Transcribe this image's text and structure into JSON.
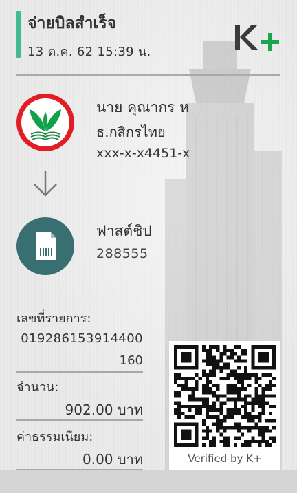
{
  "header": {
    "title": "จ่ายบิลสำเร็จ",
    "datetime": "13 ต.ค. 62  15:39 น.",
    "logo_text": "K+",
    "accent_color": "#43b98f"
  },
  "sender": {
    "name": "นาย คุณากร ห",
    "bank": "ธ.กสิกรไทย",
    "account": "xxx-x-x4451-x",
    "logo_icon": "kbank-leaf-icon"
  },
  "arrow_icon": "arrow-down-icon",
  "biller": {
    "name": "ฟาสต์ชิป",
    "code": "288555",
    "logo_icon": "bill-document-icon",
    "logo_color": "#3a6f72"
  },
  "details": {
    "ref_label": "เลขที่รายการ:",
    "ref_value_line1": "019286153914400",
    "ref_value_line2": "160",
    "amount_label": "จำนวน:",
    "amount_value": "902.00 บาท",
    "fee_label": "ค่าธรรมเนียม:",
    "fee_value": "0.00 บาท"
  },
  "qr": {
    "verified_text": "Verified by K+"
  }
}
